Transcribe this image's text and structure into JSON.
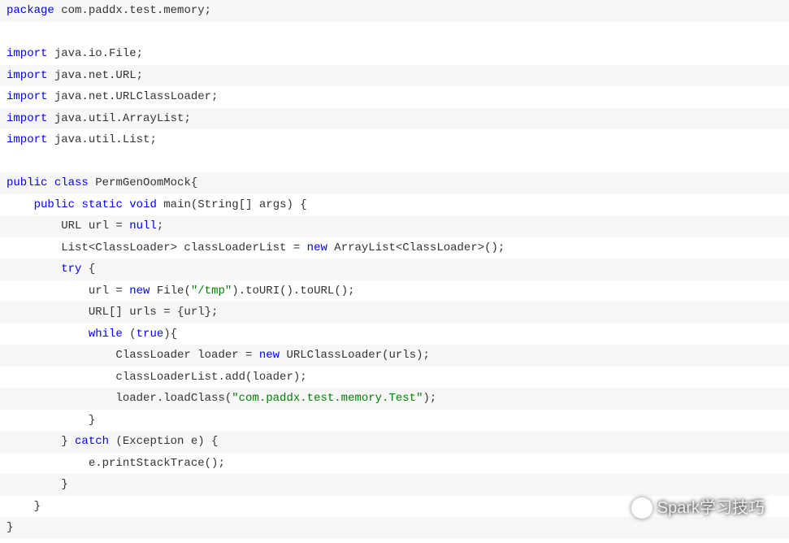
{
  "code": {
    "lines": [
      {
        "type": "code",
        "tokens": [
          {
            "t": "package",
            "c": "kw"
          },
          {
            "t": " com.paddx.test.memory;",
            "c": ""
          }
        ]
      },
      {
        "type": "blank"
      },
      {
        "type": "code",
        "tokens": [
          {
            "t": "import",
            "c": "kw"
          },
          {
            "t": " java.io.File;",
            "c": ""
          }
        ]
      },
      {
        "type": "code",
        "tokens": [
          {
            "t": "import",
            "c": "kw"
          },
          {
            "t": " java.net.URL;",
            "c": ""
          }
        ]
      },
      {
        "type": "code",
        "tokens": [
          {
            "t": "import",
            "c": "kw"
          },
          {
            "t": " java.net.URLClassLoader;",
            "c": ""
          }
        ]
      },
      {
        "type": "code",
        "tokens": [
          {
            "t": "import",
            "c": "kw"
          },
          {
            "t": " java.util.ArrayList;",
            "c": ""
          }
        ]
      },
      {
        "type": "code",
        "tokens": [
          {
            "t": "import",
            "c": "kw"
          },
          {
            "t": " java.util.List;",
            "c": ""
          }
        ]
      },
      {
        "type": "blank"
      },
      {
        "type": "code",
        "tokens": [
          {
            "t": "public",
            "c": "kw"
          },
          {
            "t": " ",
            "c": ""
          },
          {
            "t": "class",
            "c": "kw"
          },
          {
            "t": " PermGenOomMock{",
            "c": ""
          }
        ]
      },
      {
        "type": "code",
        "tokens": [
          {
            "t": "    ",
            "c": ""
          },
          {
            "t": "public",
            "c": "kw"
          },
          {
            "t": " ",
            "c": ""
          },
          {
            "t": "static",
            "c": "kw"
          },
          {
            "t": " ",
            "c": ""
          },
          {
            "t": "void",
            "c": "kw"
          },
          {
            "t": " main(String[] args) {",
            "c": ""
          }
        ]
      },
      {
        "type": "code",
        "tokens": [
          {
            "t": "        URL url = ",
            "c": ""
          },
          {
            "t": "null",
            "c": "kw"
          },
          {
            "t": ";",
            "c": ""
          }
        ]
      },
      {
        "type": "code",
        "tokens": [
          {
            "t": "        List<ClassLoader> classLoaderList = ",
            "c": ""
          },
          {
            "t": "new",
            "c": "kw"
          },
          {
            "t": " ArrayList<ClassLoader>();",
            "c": ""
          }
        ]
      },
      {
        "type": "code",
        "tokens": [
          {
            "t": "        ",
            "c": ""
          },
          {
            "t": "try",
            "c": "kw"
          },
          {
            "t": " {",
            "c": ""
          }
        ]
      },
      {
        "type": "code",
        "tokens": [
          {
            "t": "            url = ",
            "c": ""
          },
          {
            "t": "new",
            "c": "kw"
          },
          {
            "t": " File(",
            "c": ""
          },
          {
            "t": "\"/tmp\"",
            "c": "str"
          },
          {
            "t": ").toURI().toURL();",
            "c": ""
          }
        ]
      },
      {
        "type": "code",
        "tokens": [
          {
            "t": "            URL[] urls = {url};",
            "c": ""
          }
        ]
      },
      {
        "type": "code",
        "tokens": [
          {
            "t": "            ",
            "c": ""
          },
          {
            "t": "while",
            "c": "kw"
          },
          {
            "t": " (",
            "c": ""
          },
          {
            "t": "true",
            "c": "kw"
          },
          {
            "t": "){",
            "c": ""
          }
        ]
      },
      {
        "type": "code",
        "tokens": [
          {
            "t": "                ClassLoader loader = ",
            "c": ""
          },
          {
            "t": "new",
            "c": "kw"
          },
          {
            "t": " URLClassLoader(urls);",
            "c": ""
          }
        ]
      },
      {
        "type": "code",
        "tokens": [
          {
            "t": "                classLoaderList.add(loader);",
            "c": ""
          }
        ]
      },
      {
        "type": "code",
        "tokens": [
          {
            "t": "                loader.loadClass(",
            "c": ""
          },
          {
            "t": "\"com.paddx.test.memory.Test\"",
            "c": "str"
          },
          {
            "t": ");",
            "c": ""
          }
        ]
      },
      {
        "type": "code",
        "tokens": [
          {
            "t": "            }",
            "c": ""
          }
        ]
      },
      {
        "type": "code",
        "tokens": [
          {
            "t": "        } ",
            "c": ""
          },
          {
            "t": "catch",
            "c": "kw"
          },
          {
            "t": " (Exception e) {",
            "c": ""
          }
        ]
      },
      {
        "type": "code",
        "tokens": [
          {
            "t": "            e.printStackTrace();",
            "c": ""
          }
        ]
      },
      {
        "type": "code",
        "tokens": [
          {
            "t": "        }",
            "c": ""
          }
        ]
      },
      {
        "type": "code",
        "tokens": [
          {
            "t": "    }",
            "c": ""
          }
        ]
      },
      {
        "type": "code",
        "tokens": [
          {
            "t": "}",
            "c": ""
          }
        ]
      }
    ]
  },
  "watermark": {
    "text": "Spark学习技巧"
  }
}
